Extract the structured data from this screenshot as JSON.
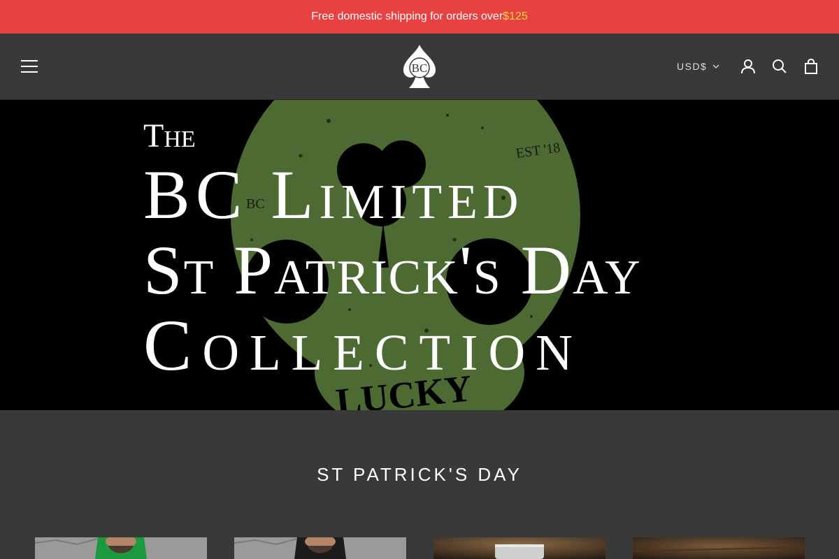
{
  "announcement": {
    "text": "Free domestic shipping for orders over ",
    "amount": "$125"
  },
  "header": {
    "logo_text": "BC",
    "currency": "USD$"
  },
  "hero": {
    "line_the": "The",
    "line1": "BC Limited",
    "line2": "St Patrick's Day",
    "line3": "Collection",
    "bg_stamp": "EST '18",
    "bg_word": "LUCKY",
    "bg_small": "BC"
  },
  "section": {
    "title": "ST PATRICK'S DAY"
  },
  "colors": {
    "announce_bg": "#e84141",
    "amount": "#ffd93d",
    "page_bg": "#3a393a",
    "skull_green": "#4c6a32"
  }
}
